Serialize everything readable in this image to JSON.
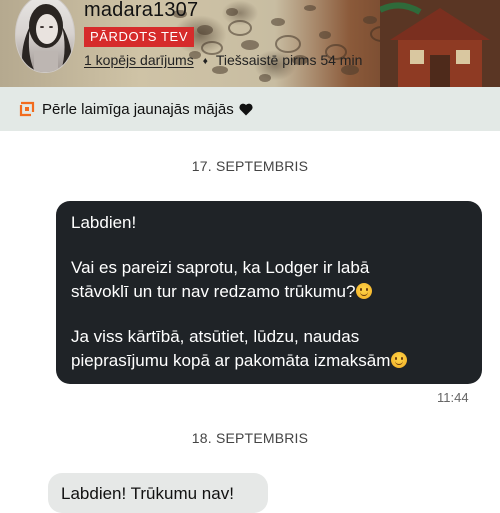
{
  "header": {
    "username": "madara1307",
    "sold_badge": "PĀRDOTS TEV",
    "transactions_link": "1 kopējs darījums",
    "separator": "♦",
    "online_status": "Tiešsaistē pirms 54 min"
  },
  "notice": {
    "icon": "parcel-status-icon",
    "text": "Pērle laimīga jaunajās mājās",
    "emoji": "black-heart"
  },
  "messages": [
    {
      "date": "17. SEPTEMBRIS",
      "direction": "outgoing",
      "lines": [
        "Labdien!",
        "Vai es pareizi saprotu, ka Lodger ir labā",
        "stāvoklī un tur nav redzamo trūkumu?",
        "Ja viss kārtībā, atsūtiet, lūdzu, naudas",
        "pieprasījumu kopā ar pakomāta izmaksām"
      ],
      "emoji": "smiling-face",
      "time": "11:44"
    },
    {
      "date": "18. SEPTEMBRIS",
      "direction": "incoming",
      "text": "Labdien! Trūkumu nav!"
    }
  ],
  "colors": {
    "badge": "#d62b2b",
    "notice_bg": "#e3e9e6",
    "notice_icon": "#f26b1d",
    "outgoing_bubble": "#1f2327",
    "incoming_bubble": "#e6e8e7"
  }
}
